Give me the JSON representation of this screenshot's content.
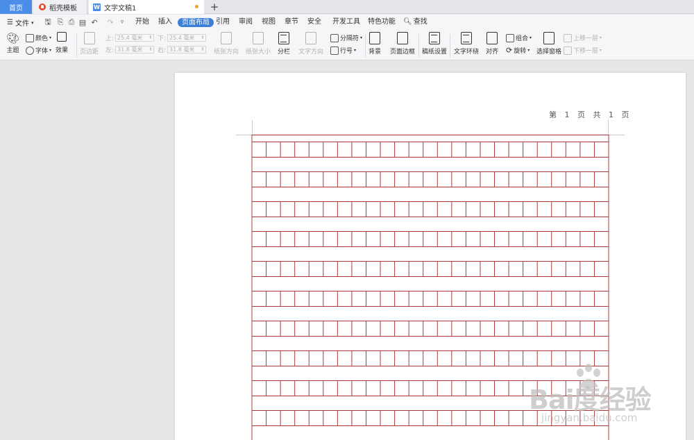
{
  "tabs": {
    "home": "首页",
    "templates": "稻壳模板",
    "document": "文字文稿1",
    "new_tab": "+"
  },
  "menu": {
    "file": "文件",
    "items": [
      "开始",
      "插入",
      "页面布局",
      "引用",
      "审阅",
      "视图",
      "章节",
      "安全",
      "开发工具",
      "特色功能"
    ],
    "active": "页面布局",
    "search": "查找"
  },
  "ribbon": {
    "theme": "主题",
    "color": "颜色",
    "font": "字体",
    "effect": "效果",
    "margins": "页边距",
    "top_label": "上:",
    "top_value": "25.4 毫米",
    "bottom_label": "下:",
    "bottom_value": "25.4 毫米",
    "left_label": "左:",
    "left_value": "31.8 毫米",
    "right_label": "右:",
    "right_value": "31.8 毫米",
    "orientation": "纸张方向",
    "size": "纸张大小",
    "columns": "分栏",
    "text_direction": "文字方向",
    "separator": "分隔符",
    "line_number": "行号",
    "background": "背景",
    "page_border": "页面边框",
    "manuscript": "稿纸设置",
    "wrap": "文字环绕",
    "align": "对齐",
    "group": "组合",
    "rotate": "旋转",
    "selection_pane": "选择窗格",
    "bring_forward": "上移一层",
    "send_backward": "下移一层"
  },
  "document": {
    "header": "第 1 页 共 1 页"
  },
  "watermark": {
    "brand": "Bai度经验",
    "url": "jingyan.baidu.com"
  },
  "colors": {
    "accent": "#3b7fd8",
    "grid_line": "#a83a3a",
    "home_tab": "#4a8ee8"
  },
  "manuscript_grid": {
    "columns": 25,
    "visible_rows": 10
  }
}
